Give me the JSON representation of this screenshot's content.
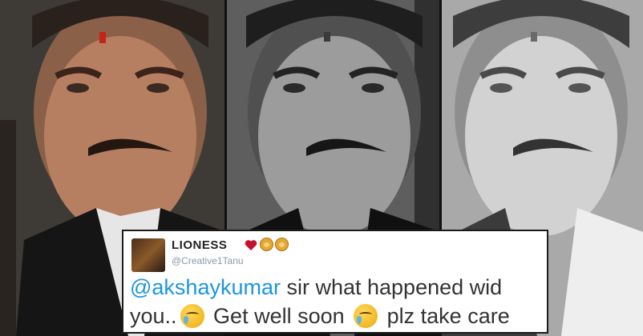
{
  "tweet": {
    "display_name": "LIONESS",
    "handle": "@Creative1Tanu",
    "name_emojis": [
      "heart-icon",
      "lion-icon",
      "lion-icon"
    ],
    "mention": "@akshaykumar",
    "line1_rest": " sir what happened wid",
    "line2_a": "you..",
    "line2_b": " Get well soon ",
    "line2_c": " plz take care",
    "colors": {
      "mention": "#1b95e0",
      "text": "#333333",
      "handle": "#8899a6"
    }
  }
}
